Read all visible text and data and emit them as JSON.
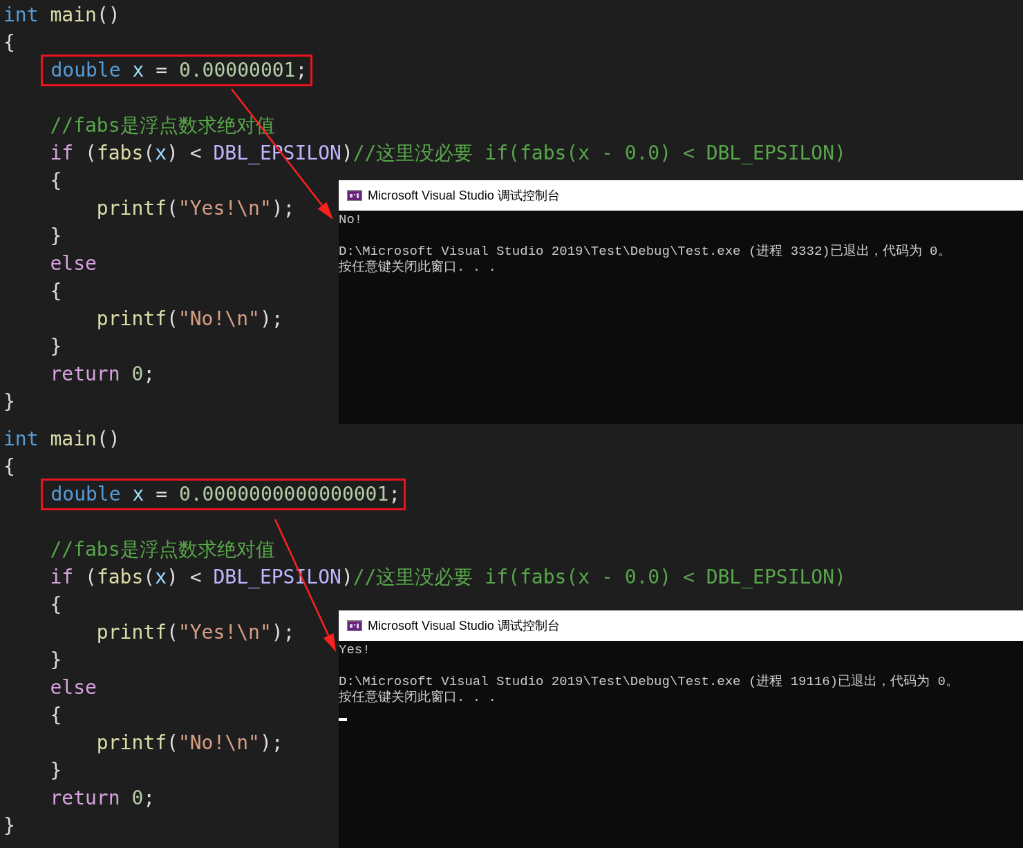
{
  "panels": [
    {
      "code_lines": [
        {
          "tokens": [
            {
              "kind": "type",
              "text": "int"
            },
            {
              "kind": "func",
              "text": " main"
            },
            {
              "kind": "plain",
              "text": "()"
            }
          ]
        },
        {
          "tokens": [
            {
              "kind": "plain",
              "text": "{"
            }
          ]
        },
        {
          "highlighted": true,
          "tokens": [
            {
              "kind": "type",
              "text": "    double"
            },
            {
              "kind": "var",
              "text": " x"
            },
            {
              "kind": "plain",
              "text": " = "
            },
            {
              "kind": "number",
              "text": "0.00000001"
            },
            {
              "kind": "plain",
              "text": ";"
            }
          ]
        },
        {
          "blank": true
        },
        {
          "tokens": [
            {
              "kind": "comment",
              "text": "    //fabs是浮点数求绝对值"
            }
          ]
        },
        {
          "tokens": [
            {
              "kind": "control",
              "text": "    if"
            },
            {
              "kind": "plain",
              "text": " ("
            },
            {
              "kind": "func",
              "text": "fabs"
            },
            {
              "kind": "plain",
              "text": "("
            },
            {
              "kind": "var",
              "text": "x"
            },
            {
              "kind": "plain",
              "text": ") < "
            },
            {
              "kind": "macro",
              "text": "DBL_EPSILON"
            },
            {
              "kind": "plain",
              "text": ")"
            },
            {
              "kind": "comment",
              "text": "//这里没必要 if(fabs(x - 0.0) < DBL_EPSILON)"
            }
          ]
        },
        {
          "tokens": [
            {
              "kind": "plain",
              "text": "    {"
            }
          ]
        },
        {
          "tokens": [
            {
              "kind": "func",
              "text": "        printf"
            },
            {
              "kind": "plain",
              "text": "("
            },
            {
              "kind": "string",
              "text": "\"Yes!\\n\""
            },
            {
              "kind": "plain",
              "text": ");"
            }
          ]
        },
        {
          "tokens": [
            {
              "kind": "plain",
              "text": "    }"
            }
          ]
        },
        {
          "tokens": [
            {
              "kind": "control",
              "text": "    else"
            }
          ]
        },
        {
          "tokens": [
            {
              "kind": "plain",
              "text": "    {"
            }
          ]
        },
        {
          "tokens": [
            {
              "kind": "func",
              "text": "        printf"
            },
            {
              "kind": "plain",
              "text": "("
            },
            {
              "kind": "string",
              "text": "\"No!\\n\""
            },
            {
              "kind": "plain",
              "text": ");"
            }
          ]
        },
        {
          "tokens": [
            {
              "kind": "plain",
              "text": "    }"
            }
          ]
        },
        {
          "tokens": [
            {
              "kind": "control",
              "text": "    return"
            },
            {
              "kind": "number",
              "text": " 0"
            },
            {
              "kind": "plain",
              "text": ";"
            }
          ]
        },
        {
          "tokens": [
            {
              "kind": "plain",
              "text": "}"
            }
          ]
        }
      ],
      "console": {
        "title": "Microsoft Visual Studio 调试控制台",
        "output": [
          {
            "text": "No!"
          },
          {
            "blank": true
          },
          {
            "text": "D:\\Microsoft Visual Studio 2019\\Test\\Debug\\Test.exe (进程 3332)已退出，代码为 0。"
          },
          {
            "text": "按任意键关闭此窗口. . ."
          }
        ]
      }
    },
    {
      "code_lines": [
        {
          "tokens": [
            {
              "kind": "type",
              "text": "int"
            },
            {
              "kind": "func",
              "text": " main"
            },
            {
              "kind": "plain",
              "text": "()"
            }
          ]
        },
        {
          "tokens": [
            {
              "kind": "plain",
              "text": "{"
            }
          ]
        },
        {
          "highlighted": true,
          "tokens": [
            {
              "kind": "type",
              "text": "    double"
            },
            {
              "kind": "var",
              "text": " x"
            },
            {
              "kind": "plain",
              "text": " = "
            },
            {
              "kind": "number",
              "text": "0.0000000000000001"
            },
            {
              "kind": "plain",
              "text": ";"
            }
          ]
        },
        {
          "blank": true
        },
        {
          "tokens": [
            {
              "kind": "comment",
              "text": "    //fabs是浮点数求绝对值"
            }
          ]
        },
        {
          "tokens": [
            {
              "kind": "control",
              "text": "    if"
            },
            {
              "kind": "plain",
              "text": " ("
            },
            {
              "kind": "func",
              "text": "fabs"
            },
            {
              "kind": "plain",
              "text": "("
            },
            {
              "kind": "var",
              "text": "x"
            },
            {
              "kind": "plain",
              "text": ") < "
            },
            {
              "kind": "macro",
              "text": "DBL_EPSILON"
            },
            {
              "kind": "plain",
              "text": ")"
            },
            {
              "kind": "comment",
              "text": "//这里没必要 if(fabs(x - 0.0) < DBL_EPSILON)"
            }
          ]
        },
        {
          "tokens": [
            {
              "kind": "plain",
              "text": "    {"
            }
          ]
        },
        {
          "tokens": [
            {
              "kind": "func",
              "text": "        printf"
            },
            {
              "kind": "plain",
              "text": "("
            },
            {
              "kind": "string",
              "text": "\"Yes!\\n\""
            },
            {
              "kind": "plain",
              "text": ");"
            }
          ]
        },
        {
          "tokens": [
            {
              "kind": "plain",
              "text": "    }"
            }
          ]
        },
        {
          "tokens": [
            {
              "kind": "control",
              "text": "    else"
            }
          ]
        },
        {
          "tokens": [
            {
              "kind": "plain",
              "text": "    {"
            }
          ]
        },
        {
          "tokens": [
            {
              "kind": "func",
              "text": "        printf"
            },
            {
              "kind": "plain",
              "text": "("
            },
            {
              "kind": "string",
              "text": "\"No!\\n\""
            },
            {
              "kind": "plain",
              "text": ");"
            }
          ]
        },
        {
          "tokens": [
            {
              "kind": "plain",
              "text": "    }"
            }
          ]
        },
        {
          "tokens": [
            {
              "kind": "control",
              "text": "    return"
            },
            {
              "kind": "number",
              "text": " 0"
            },
            {
              "kind": "plain",
              "text": ";"
            }
          ]
        },
        {
          "tokens": [
            {
              "kind": "plain",
              "text": "}"
            }
          ]
        }
      ],
      "console": {
        "title": "Microsoft Visual Studio 调试控制台",
        "output": [
          {
            "text": "Yes!"
          },
          {
            "blank": true
          },
          {
            "text": "D:\\Microsoft Visual Studio 2019\\Test\\Debug\\Test.exe (进程 19116)已退出，代码为 0。"
          },
          {
            "text": "按任意键关闭此窗口. . ."
          }
        ],
        "cursor": true
      }
    }
  ]
}
